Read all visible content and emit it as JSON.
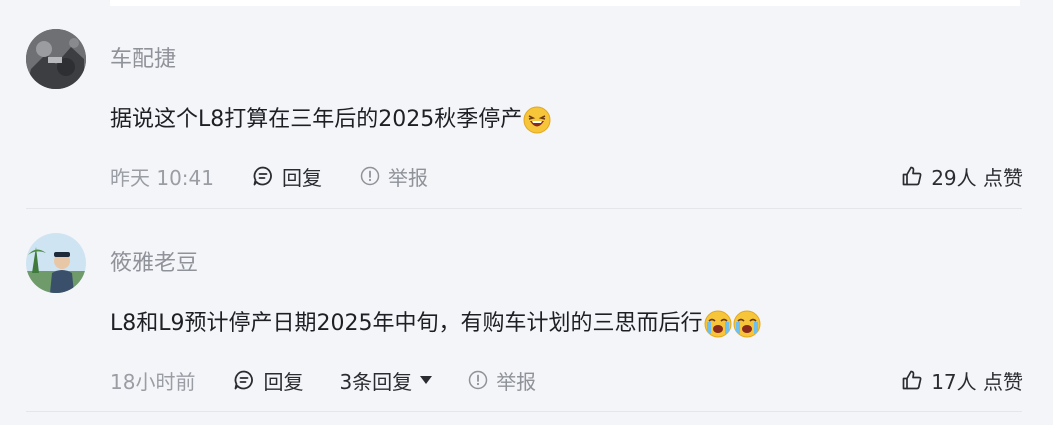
{
  "comments": [
    {
      "username": "车配捷",
      "text": "据说这个L8打算在三年后的2025秋季停产",
      "time": "昨天 10:41",
      "reply_label": "回复",
      "report_label": "举报",
      "like_text": "29人 点赞"
    },
    {
      "username": "筱雅老豆",
      "text": "L8和L9预计停产日期2025年中旬，有购车计划的三思而后行",
      "time": "18小时前",
      "reply_label": "回复",
      "replies_label": "3条回复",
      "report_label": "举报",
      "like_text": "17人 点赞"
    }
  ],
  "colors": {
    "page_bg": "#f4f5f9",
    "muted_text": "#8f9299",
    "body_text": "#1d1f24",
    "emoji_yellow": "#f7c53a"
  },
  "icons": [
    "comment-icon",
    "warning-circle-icon",
    "thumbs-up-icon",
    "laughing-emoji-icon",
    "crying-emoji-icon",
    "caret-down-icon"
  ]
}
